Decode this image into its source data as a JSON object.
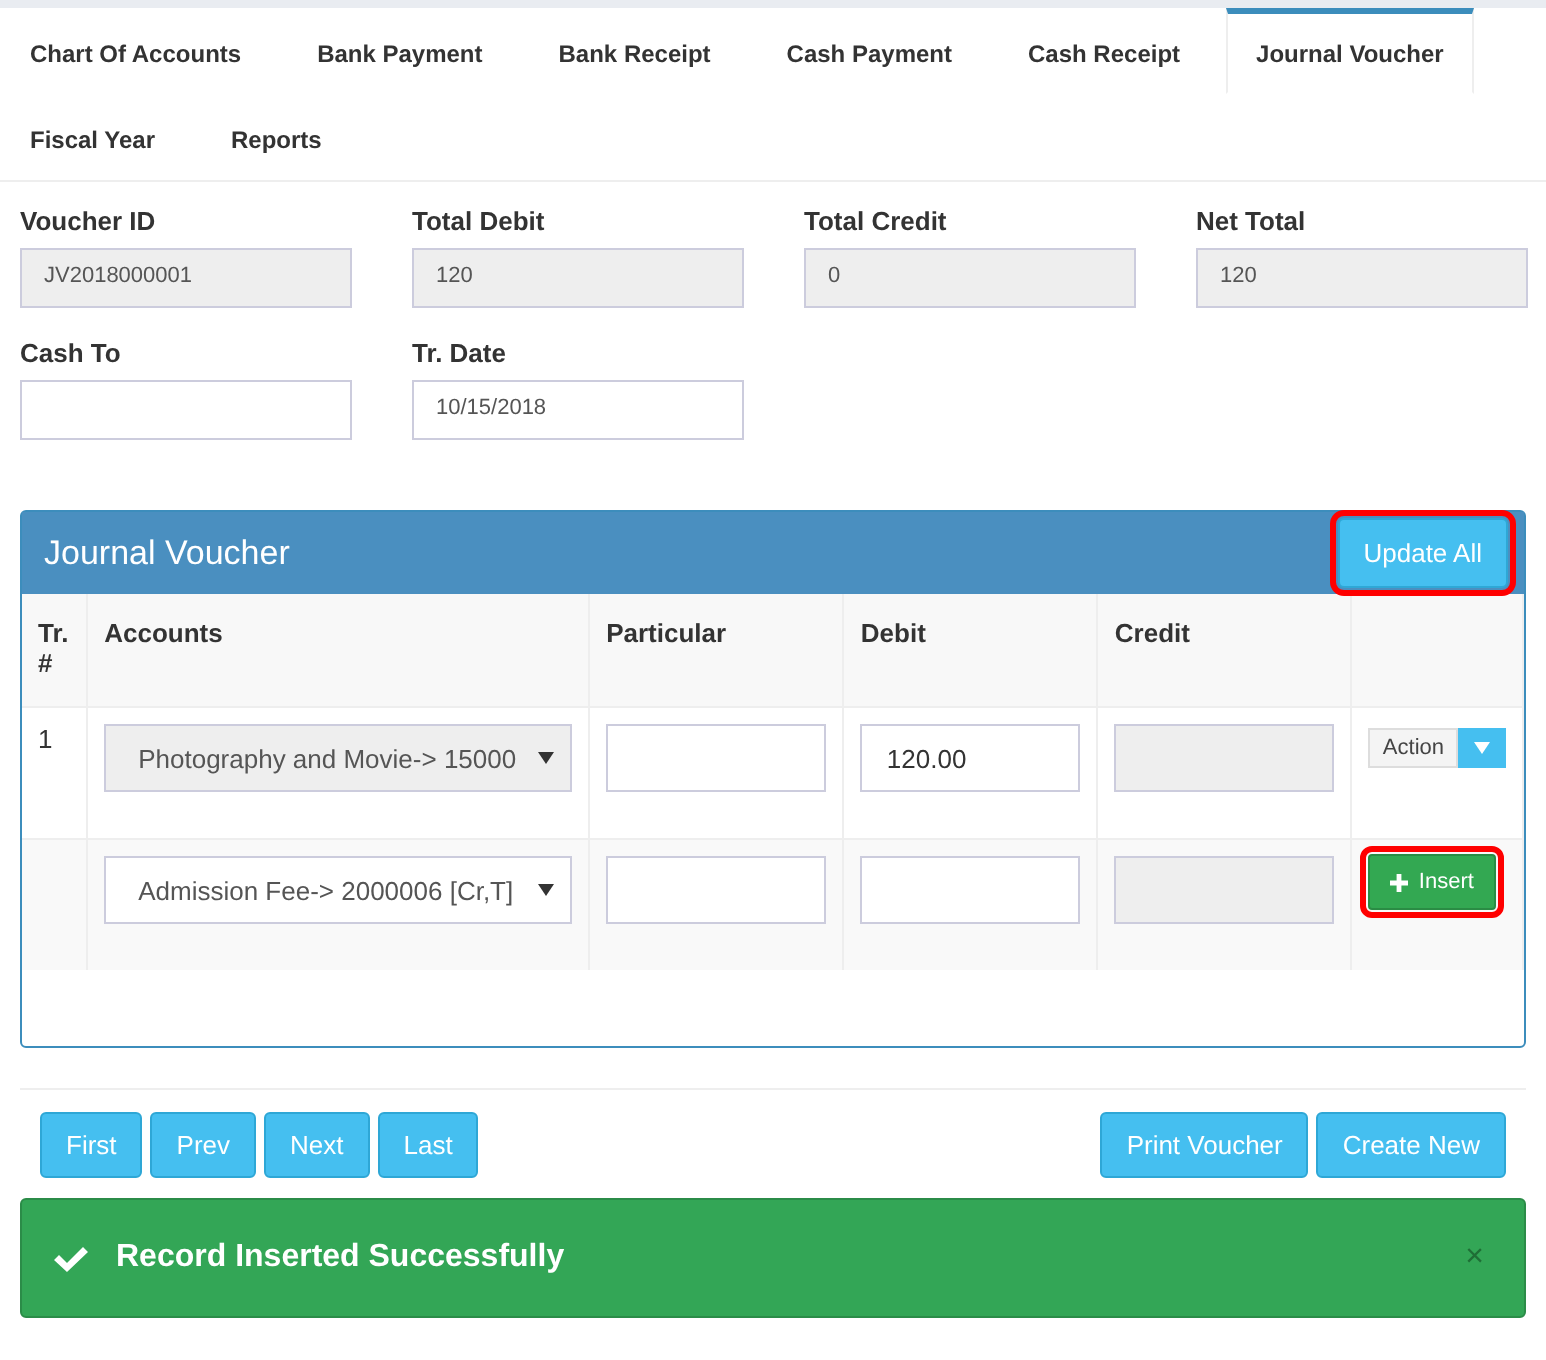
{
  "tabs": [
    {
      "label": "Chart Of Accounts",
      "selected": false
    },
    {
      "label": "Bank Payment",
      "selected": false
    },
    {
      "label": "Bank Receipt",
      "selected": false
    },
    {
      "label": "Cash Payment",
      "selected": false
    },
    {
      "label": "Cash Receipt",
      "selected": false
    },
    {
      "label": "Journal Voucher",
      "selected": true
    },
    {
      "label": "Fiscal Year",
      "selected": false
    },
    {
      "label": "Reports",
      "selected": false
    }
  ],
  "fields": [
    {
      "label": "Voucher ID",
      "value": "JV2018000001",
      "readonly": true
    },
    {
      "label": "Total Debit",
      "value": "120",
      "readonly": true
    },
    {
      "label": "Total Credit",
      "value": "0",
      "readonly": true
    },
    {
      "label": "Net Total",
      "value": "120",
      "readonly": true
    },
    {
      "label": "Cash To",
      "readonly": false
    },
    {
      "label": "Tr. Date",
      "value": "10/15/2018",
      "readonly": false
    }
  ],
  "panel": {
    "title": "Journal Voucher",
    "update_button": {
      "label": "Update All",
      "highlighted": true
    },
    "columns": [
      "Tr. #",
      "Accounts",
      "Particular",
      "Debit",
      "Credit"
    ],
    "rows": [
      {
        "kind": "entry",
        "number": "1",
        "account": "Photography and Movie-> 15000",
        "account_disabled": true,
        "debit": "120.00",
        "action": "Action"
      },
      {
        "kind": "new",
        "account": "Admission Fee-> 2000006 [Cr,T]",
        "account_disabled": false,
        "insert": {
          "label": "Insert",
          "highlighted": true
        }
      }
    ]
  },
  "nav_buttons": [
    "First",
    "Prev",
    "Next",
    "Last"
  ],
  "right_buttons": [
    "Print Voucher",
    "Create New"
  ],
  "alert": {
    "message": "Record Inserted Successfully",
    "close": "×"
  }
}
